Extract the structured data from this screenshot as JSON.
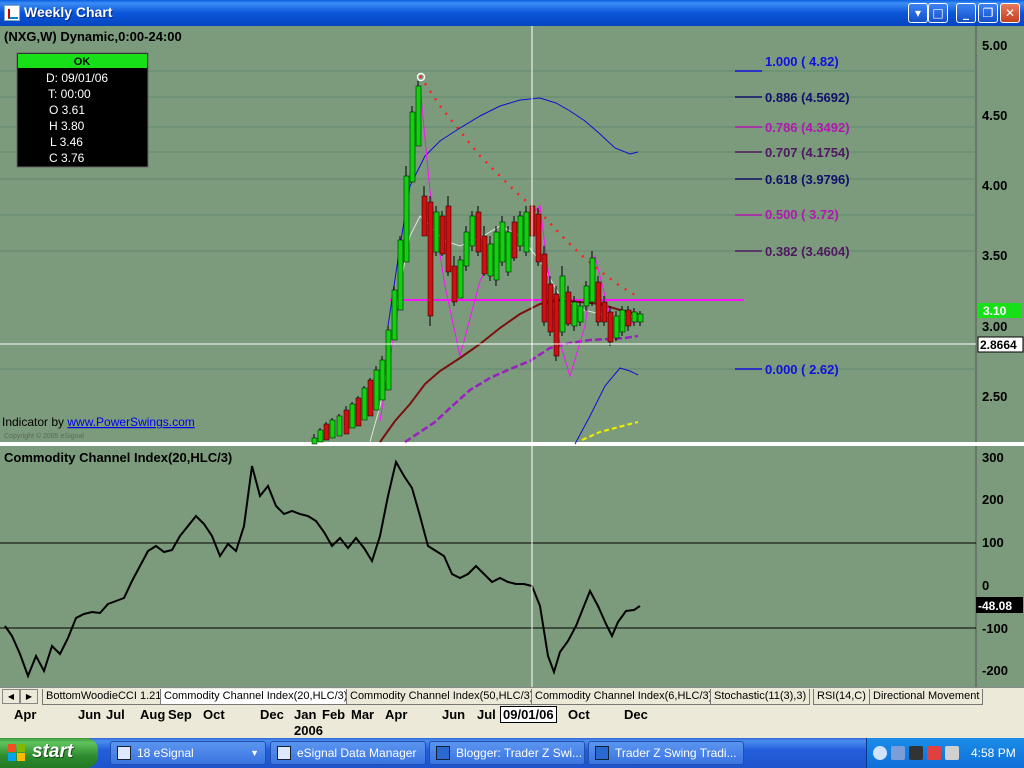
{
  "window": {
    "title": "Weekly Chart"
  },
  "chart": {
    "header": "(NXG,W) Dynamic,0:00-24:00",
    "cursor_date": "09/01/06",
    "ohlc_box": {
      "status": "OK",
      "rows": [
        "D: 09/01/06",
        "T: 00:00",
        "O  3.61",
        "H  3.80",
        "L  3.46",
        "C  3.76"
      ]
    },
    "indicator_credit": {
      "prefix": "Indicator by ",
      "link": "www.PowerSwings.com"
    },
    "copyright": "Copyright © 2005 eSignal",
    "price_axis": [
      "5.00",
      "4.50",
      "4.00",
      "3.50",
      "3.00",
      "2.50"
    ],
    "last_price": "3.10",
    "crosshair_price": "2.8664",
    "fib_levels": [
      {
        "label": "1.000 ( 4.82)",
        "color": "#1010e0"
      },
      {
        "label": "0.886 (4.5692)",
        "color": "#10106a"
      },
      {
        "label": "0.786 (4.3492)",
        "color": "#b018b0"
      },
      {
        "label": "0.707 (4.1754)",
        "color": "#501860"
      },
      {
        "label": "0.618 (3.9796)",
        "color": "#10106a"
      },
      {
        "label": "0.500 ( 3.72)",
        "color": "#b018b0"
      },
      {
        "label": "0.382 (3.4604)",
        "color": "#501860"
      },
      {
        "label": "0.000 ( 2.62)",
        "color": "#1010e0"
      }
    ],
    "cci_title": "Commodity Channel Index(20,HLC/3)",
    "cci_axis": [
      "300",
      "200",
      "100",
      "0",
      "-100",
      "-200"
    ],
    "cci_last": "-48.08",
    "colors": {
      "background": "#7c9a7c",
      "up": "#10d010",
      "down": "#d01010",
      "magenta": "#ff10ff"
    }
  },
  "tabs": [
    "BottomWoodieCCI 1.21",
    "Commodity Channel Index(20,HLC/3)",
    "Commodity Channel Index(50,HLC/3)",
    "Commodity Channel Index(6,HLC/3)",
    "Stochastic(11(3),3)",
    "RSI(14,C)",
    "Directional Movement"
  ],
  "x_axis": {
    "months": [
      "Apr",
      "Jun",
      "Jul",
      "Aug",
      "Sep",
      "Oct",
      "Dec",
      "Jan",
      "Feb",
      "Mar",
      "Apr",
      "Jun",
      "Jul",
      "Oct",
      "Dec"
    ],
    "year": "2006",
    "cursor_label": "09/01/06"
  },
  "taskbar": {
    "start": "start",
    "tasks": [
      "18 eSignal",
      "eSignal Data Manager",
      "Blogger: Trader Z Swi...",
      "Trader Z Swing Tradi..."
    ],
    "clock": "4:58 PM"
  }
}
